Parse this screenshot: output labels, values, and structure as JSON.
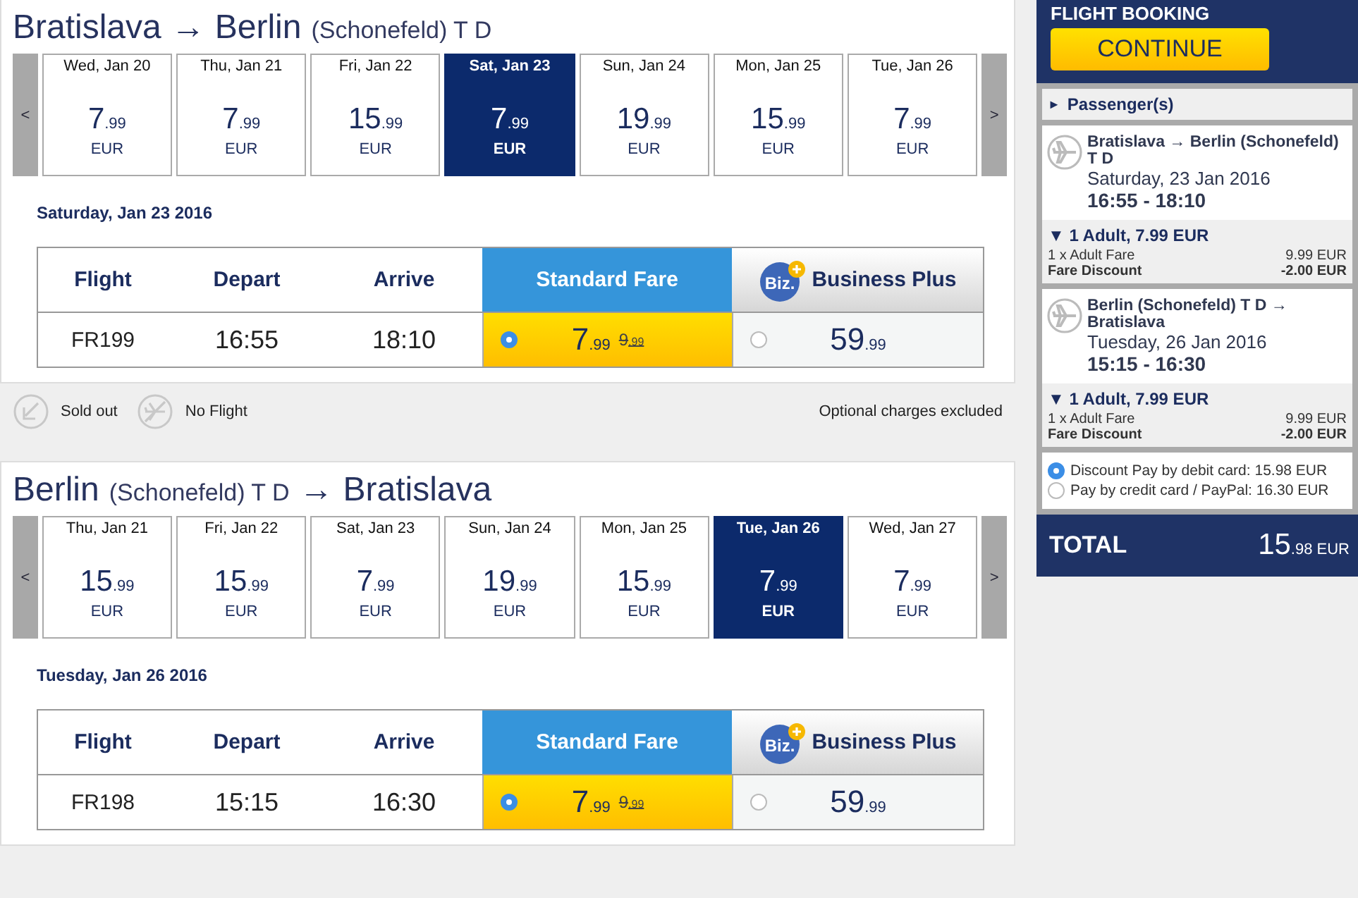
{
  "legs": [
    {
      "title": [
        {
          "kind": "city",
          "text": "Bratislava"
        },
        {
          "kind": "arrow",
          "text": "→"
        },
        {
          "kind": "city",
          "text": "Berlin"
        },
        {
          "kind": "note",
          "text": "(Schonefeld) T D"
        }
      ],
      "prev": "<",
      "next": ">",
      "dates": [
        {
          "day": "Wed, Jan 20",
          "whole": "7",
          "cents": ".99",
          "currency": "EUR",
          "selected": false
        },
        {
          "day": "Thu, Jan 21",
          "whole": "7",
          "cents": ".99",
          "currency": "EUR",
          "selected": false
        },
        {
          "day": "Fri, Jan 22",
          "whole": "15",
          "cents": ".99",
          "currency": "EUR",
          "selected": false
        },
        {
          "day": "Sat, Jan 23",
          "whole": "7",
          "cents": ".99",
          "currency": "EUR",
          "selected": true
        },
        {
          "day": "Sun, Jan 24",
          "whole": "19",
          "cents": ".99",
          "currency": "EUR",
          "selected": false
        },
        {
          "day": "Mon, Jan 25",
          "whole": "15",
          "cents": ".99",
          "currency": "EUR",
          "selected": false
        },
        {
          "day": "Tue, Jan 26",
          "whole": "7",
          "cents": ".99",
          "currency": "EUR",
          "selected": false
        }
      ],
      "date_heading": "Saturday, Jan 23 2016",
      "columns": [
        "Flight",
        "Depart",
        "Arrive"
      ],
      "standard_header": "Standard Fare",
      "business_header": "Business Plus",
      "business_badge": "Biz.",
      "flight": {
        "number": "FR199",
        "depart": "16:55",
        "arrive": "18:10",
        "standard": {
          "whole": "7",
          "cents": ".99",
          "old_whole": "9",
          "old_cents": ".99",
          "selected": true
        },
        "business": {
          "whole": "59",
          "cents": ".99",
          "selected": false
        }
      },
      "legend": {
        "sold_out": "Sold out",
        "no_flight": "No Flight",
        "note": "Optional charges excluded"
      }
    },
    {
      "title": [
        {
          "kind": "city",
          "text": "Berlin"
        },
        {
          "kind": "note",
          "text": "(Schonefeld) T D"
        },
        {
          "kind": "arrow",
          "text": "→"
        },
        {
          "kind": "city",
          "text": "Bratislava"
        }
      ],
      "prev": "<",
      "next": ">",
      "dates": [
        {
          "day": "Thu, Jan 21",
          "whole": "15",
          "cents": ".99",
          "currency": "EUR",
          "selected": false
        },
        {
          "day": "Fri, Jan 22",
          "whole": "15",
          "cents": ".99",
          "currency": "EUR",
          "selected": false
        },
        {
          "day": "Sat, Jan 23",
          "whole": "7",
          "cents": ".99",
          "currency": "EUR",
          "selected": false
        },
        {
          "day": "Sun, Jan 24",
          "whole": "19",
          "cents": ".99",
          "currency": "EUR",
          "selected": false
        },
        {
          "day": "Mon, Jan 25",
          "whole": "15",
          "cents": ".99",
          "currency": "EUR",
          "selected": false
        },
        {
          "day": "Tue, Jan 26",
          "whole": "7",
          "cents": ".99",
          "currency": "EUR",
          "selected": true
        },
        {
          "day": "Wed, Jan 27",
          "whole": "7",
          "cents": ".99",
          "currency": "EUR",
          "selected": false
        }
      ],
      "date_heading": "Tuesday, Jan 26 2016",
      "columns": [
        "Flight",
        "Depart",
        "Arrive"
      ],
      "standard_header": "Standard Fare",
      "business_header": "Business Plus",
      "business_badge": "Biz.",
      "flight": {
        "number": "FR198",
        "depart": "15:15",
        "arrive": "16:30",
        "standard": {
          "whole": "7",
          "cents": ".99",
          "old_whole": "9",
          "old_cents": ".99",
          "selected": true
        },
        "business": {
          "whole": "59",
          "cents": ".99",
          "selected": false
        }
      }
    }
  ],
  "booking": {
    "title": "FLIGHT BOOKING",
    "continue": "CONTINUE",
    "passengers": {
      "marker": "►",
      "label": "Passenger(s)"
    },
    "trips": [
      {
        "route": "Bratislava → Berlin (Schonefeld) T D",
        "date": "Saturday, 23 Jan 2016",
        "time": "16:55 - 18:10",
        "fare_marker": "▼",
        "fare": "1 Adult, 7.99 EUR",
        "lines": [
          {
            "label": "1 x Adult Fare",
            "amount": "9.99 EUR",
            "bold": false
          },
          {
            "label": "Fare Discount",
            "amount": "-2.00 EUR",
            "bold": true
          }
        ]
      },
      {
        "route": "Berlin (Schonefeld) T D → Bratislava",
        "date": "Tuesday, 26 Jan 2016",
        "time": "15:15 - 16:30",
        "fare_marker": "▼",
        "fare": "1 Adult, 7.99 EUR",
        "lines": [
          {
            "label": "1 x Adult Fare",
            "amount": "9.99 EUR",
            "bold": false
          },
          {
            "label": "Fare Discount",
            "amount": "-2.00 EUR",
            "bold": true
          }
        ]
      }
    ],
    "payment": [
      {
        "label": "Discount Pay by debit card: 15.98 EUR",
        "selected": true
      },
      {
        "label": "Pay by credit card / PayPal: 16.30 EUR",
        "selected": false
      }
    ],
    "total": {
      "label": "TOTAL",
      "whole": "15",
      "cents": ".98",
      "currency": "EUR"
    }
  }
}
